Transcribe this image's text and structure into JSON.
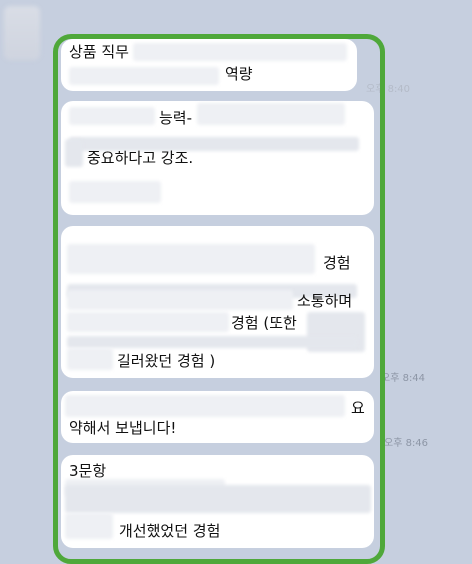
{
  "messages": [
    {
      "lines": [
        "상품 직무",
        "역량"
      ]
    },
    {
      "lines": [
        "능력-",
        "중요하다고 강조."
      ]
    },
    {
      "lines": [
        "경험",
        "소통하며",
        "경험 (또한",
        "길러왔던 경험 )"
      ]
    },
    {
      "lines": [
        "요",
        "약해서 보냅니다!"
      ]
    },
    {
      "lines": [
        "3문항",
        "개선했었던 경험"
      ]
    }
  ],
  "timestamps": [
    "오후 8:40",
    "오후 8:44",
    "오후 8:46"
  ],
  "colors": {
    "background": "#c6cfdf",
    "bubble": "#ffffff",
    "highlight": "#4fa83a",
    "timestamp": "#8d96a6"
  }
}
